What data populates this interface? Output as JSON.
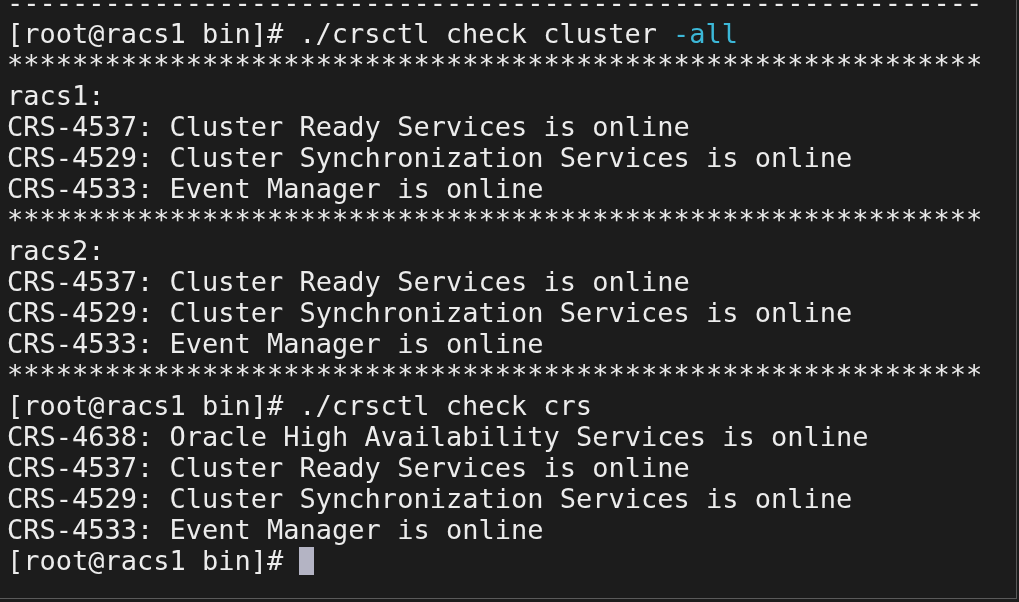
{
  "terminal": {
    "lines": [
      {
        "kind": "output",
        "text": "------------------------------------------------------------"
      },
      {
        "kind": "command",
        "prompt": "[root@racs1 bin]#",
        "command": "./crsctl check cluster",
        "option": "-all",
        "cursor": false
      },
      {
        "kind": "output",
        "text": "************************************************************"
      },
      {
        "kind": "output",
        "text": "racs1:"
      },
      {
        "kind": "output",
        "text": "CRS-4537: Cluster Ready Services is online"
      },
      {
        "kind": "output",
        "text": "CRS-4529: Cluster Synchronization Services is online"
      },
      {
        "kind": "output",
        "text": "CRS-4533: Event Manager is online"
      },
      {
        "kind": "output",
        "text": "************************************************************"
      },
      {
        "kind": "output",
        "text": "racs2:"
      },
      {
        "kind": "output",
        "text": "CRS-4537: Cluster Ready Services is online"
      },
      {
        "kind": "output",
        "text": "CRS-4529: Cluster Synchronization Services is online"
      },
      {
        "kind": "output",
        "text": "CRS-4533: Event Manager is online"
      },
      {
        "kind": "output",
        "text": "************************************************************"
      },
      {
        "kind": "command",
        "prompt": "[root@racs1 bin]#",
        "command": "./crsctl check crs",
        "cursor": false
      },
      {
        "kind": "output",
        "text": "CRS-4638: Oracle High Availability Services is online"
      },
      {
        "kind": "output",
        "text": "CRS-4537: Cluster Ready Services is online"
      },
      {
        "kind": "output",
        "text": "CRS-4529: Cluster Synchronization Services is online"
      },
      {
        "kind": "output",
        "text": "CRS-4533: Event Manager is online"
      },
      {
        "kind": "command",
        "prompt": "[root@racs1 bin]#",
        "cursor": true
      }
    ]
  }
}
